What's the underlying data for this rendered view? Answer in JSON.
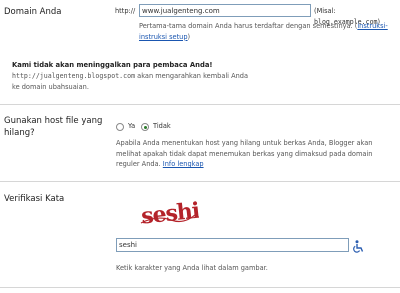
{
  "domain_section": {
    "label": "Domain Anda",
    "prefix": "http://",
    "input_value": "www.jualgenteng.com",
    "example_prefix": "(Misal: ",
    "example_domain": "blog.example.com",
    "example_suffix": ")",
    "help_text": "Pertama-tama domain Anda harus terdaftar dengan semestinya. (",
    "help_link": "instruksi-instruksi setup",
    "help_end": ")"
  },
  "notice": {
    "title": "Kami tidak akan meninggalkan para pembaca Anda!",
    "old_blog": "http://jualgenteng.blogspot.com",
    "text_after": " akan mengarahkan kembali Anda",
    "line2": "ke domain ubahsuaian."
  },
  "host_section": {
    "label": "Gunakan host file yang hilang?",
    "option_yes": "Ya",
    "option_no": "Tidak",
    "selected": "Tidak",
    "help_text": "Apabila Anda menentukan host yang hilang untuk berkas Anda, Blogger akan melihat apakah tidak dapat menemukan berkas yang dimaksud pada domain reguler Anda. ",
    "help_link": "Info lengkap"
  },
  "verify_section": {
    "label": "Verifikasi Kata",
    "captcha_word": "seshi",
    "input_value": "seshi",
    "help_text": "Ketik karakter yang Anda lihat dalam gambar."
  },
  "icons": {
    "accessibility": "wheelchair-icon"
  }
}
